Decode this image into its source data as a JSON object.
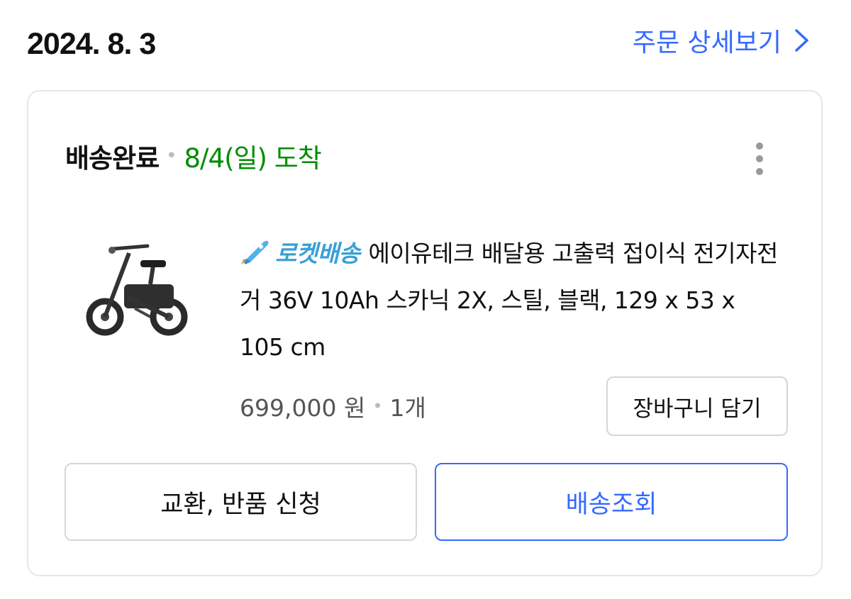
{
  "header": {
    "order_date": "2024. 8. 3",
    "detail_link": "주문 상세보기"
  },
  "card": {
    "status": "배송완료",
    "arrival": "8/4(일) 도착",
    "product": {
      "badge": "로켓배송",
      "title": "에이유테크 배달용 고출력 접이식 전기자전거 36V 10Ah 스카닉 2X, 스틸, 블랙, 129 x 53 x 105 cm",
      "price": "699,000 원",
      "quantity": "1개"
    },
    "buttons": {
      "cart": "장바구니 담기",
      "return": "교환, 반품 신청",
      "tracking": "배송조회"
    }
  },
  "colors": {
    "link_blue": "#346aff",
    "arrival_green": "#008c00",
    "rocket_blue": "#3ba0d6"
  },
  "icons": [
    "chevron-right-icon",
    "more-vertical-icon",
    "rocket-icon"
  ]
}
